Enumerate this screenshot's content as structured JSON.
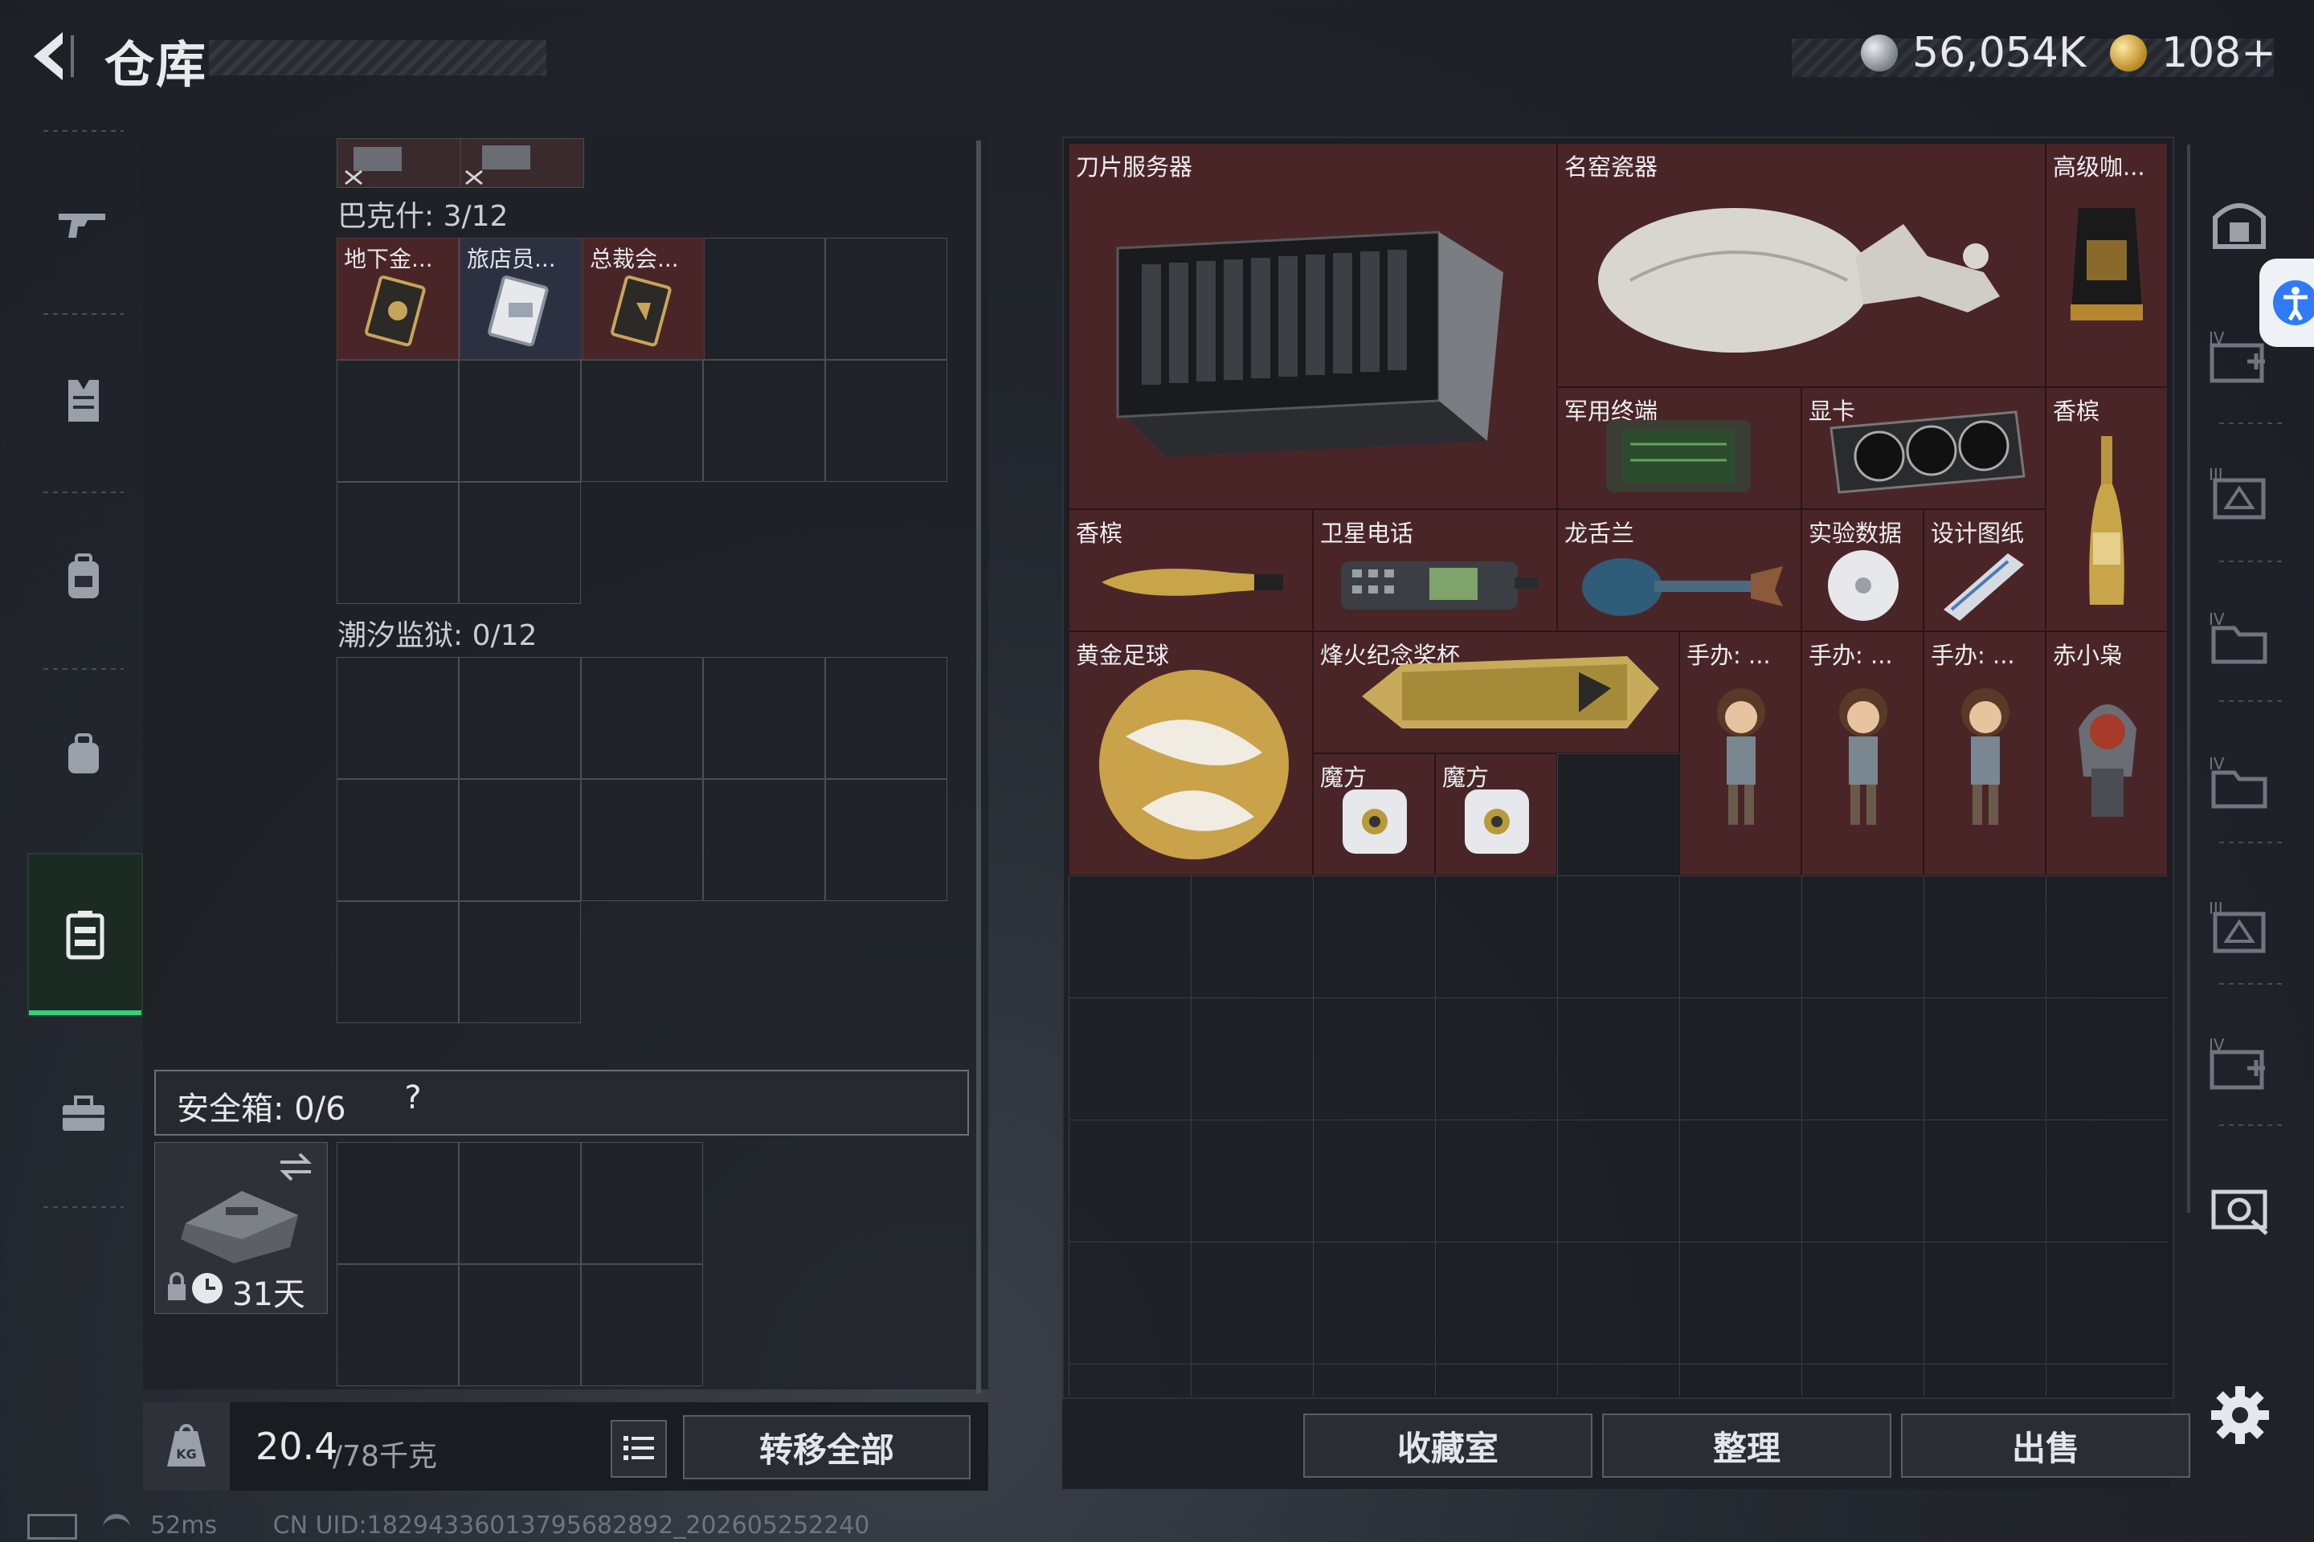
{
  "header": {
    "title": "仓库",
    "currency_silver": "56,054K",
    "currency_gold": "108+"
  },
  "left_nav": {
    "items": [
      "weapon-icon",
      "vest-icon",
      "backpack-icon",
      "bag-icon",
      "storage-icon",
      "toolbox-icon"
    ],
    "active": 4
  },
  "left_panel": {
    "bakeshi": {
      "label": "巴克什: 3/12",
      "items": [
        "地下金...",
        "旅店员...",
        "总裁会..."
      ]
    },
    "chaoxi": {
      "label": "潮汐监狱: 0/12"
    },
    "safebox": {
      "label": "安全箱: 0/6",
      "help": "?",
      "days": "31天"
    },
    "weight": {
      "value": "20.4",
      "max": "/78千克"
    },
    "transfer_all": "转移全部"
  },
  "right_items": [
    {
      "name": "刀片服务器"
    },
    {
      "name": "名窑瓷器"
    },
    {
      "name": "高级咖..."
    },
    {
      "name": "军用终端"
    },
    {
      "name": "显卡"
    },
    {
      "name": "香槟"
    },
    {
      "name": "香槟"
    },
    {
      "name": "卫星电话"
    },
    {
      "name": "龙舌兰"
    },
    {
      "name": "实验数据"
    },
    {
      "name": "设计图纸"
    },
    {
      "name": "黄金足球"
    },
    {
      "name": "烽火纪念奖杯"
    },
    {
      "name": "手办: ..."
    },
    {
      "name": "手办: ..."
    },
    {
      "name": "手办: ..."
    },
    {
      "name": "赤小枭"
    },
    {
      "name": "魔方"
    },
    {
      "name": "魔方"
    }
  ],
  "right_buttons": {
    "collection": "收藏室",
    "sort": "整理",
    "sell": "出售"
  },
  "status": {
    "ping": "52ms",
    "uid": "CN UID:18294336013795682892_202605252240"
  }
}
